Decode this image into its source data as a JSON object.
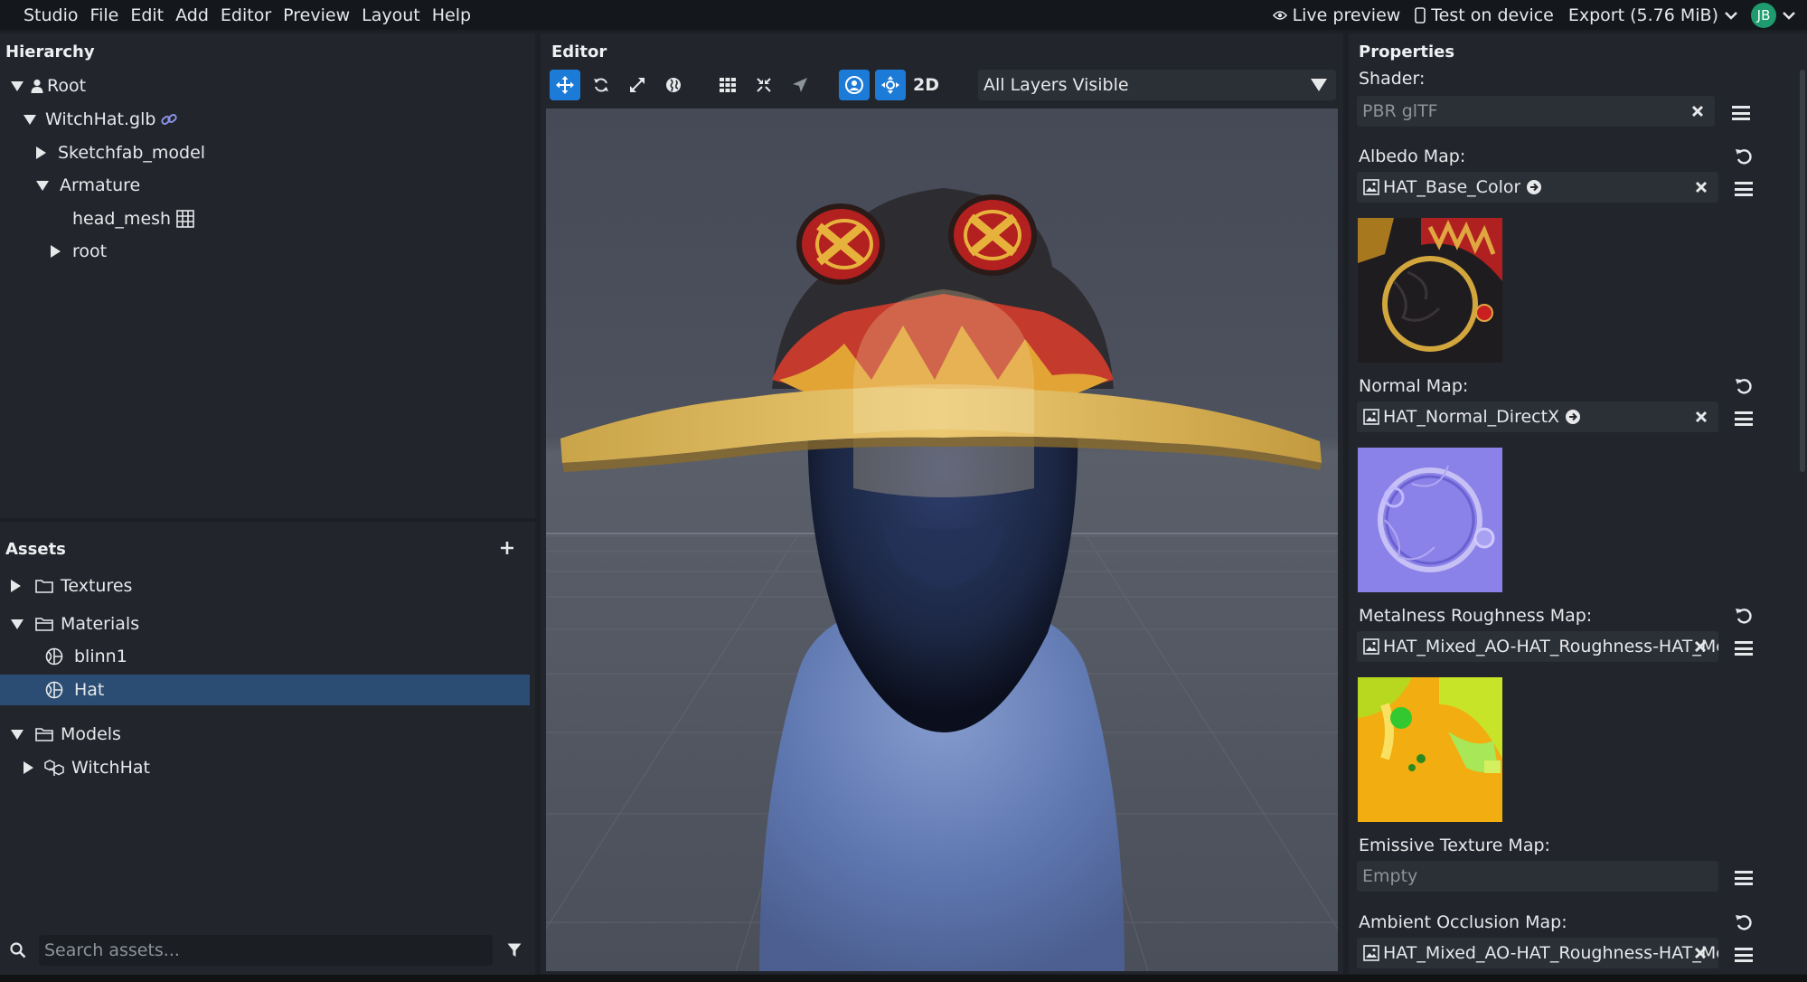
{
  "menubar": {
    "items": [
      "Studio",
      "File",
      "Edit",
      "Add",
      "Editor",
      "Preview",
      "Layout",
      "Help"
    ],
    "live_preview": "Live preview",
    "test_on_device": "Test on device",
    "export": "Export (5.76 MiB)",
    "avatar_initials": "JB"
  },
  "hierarchy": {
    "title": "Hierarchy",
    "nodes": [
      "Root",
      "WitchHat.glb",
      "Sketchfab_model",
      "Armature",
      "head_mesh",
      "root"
    ]
  },
  "assets": {
    "title": "Assets",
    "folders": [
      "Textures",
      "Materials",
      "Models"
    ],
    "materials": [
      "blinn1",
      "Hat"
    ],
    "models": [
      "WitchHat"
    ],
    "search_placeholder": "Search assets..."
  },
  "editor": {
    "title": "Editor",
    "mode_2d": "2D",
    "layer_select": "All Layers Visible"
  },
  "properties": {
    "title": "Properties",
    "shader_label": "Shader:",
    "shader_value": "PBR glTF",
    "albedo_label": "Albedo Map:",
    "albedo_value": "HAT_Base_Color",
    "normal_label": "Normal Map:",
    "normal_value": "HAT_Normal_DirectX",
    "metal_label": "Metalness Roughness Map:",
    "metal_value": "HAT_Mixed_AO-HAT_Roughness-HAT_Meta",
    "emissive_label": "Emissive Texture Map:",
    "emissive_value": "Empty",
    "ao_label": "Ambient Occlusion Map:",
    "ao_value": "HAT_Mixed_AO-HAT_Roughness-HAT_Meta"
  },
  "colors": {
    "accent": "#1d7bd8",
    "selection": "#2b4d73",
    "panel": "#22262c",
    "avatar": "#1e9c6f"
  }
}
